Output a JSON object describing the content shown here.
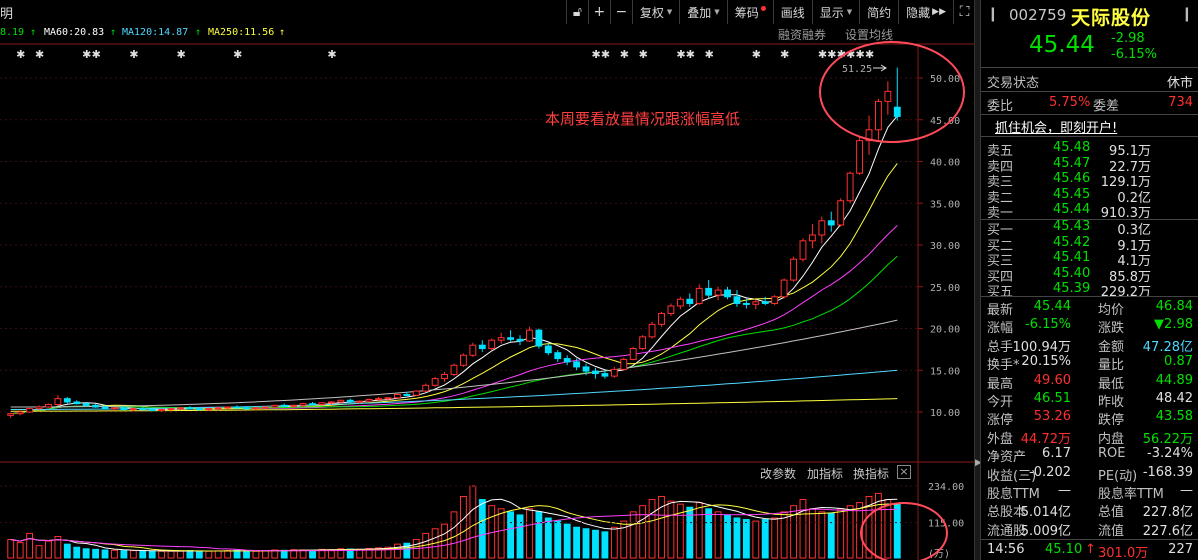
{
  "toolbar": {
    "left_text": "明",
    "items": [
      {
        "label": "复权",
        "caret": true
      },
      {
        "label": "叠加",
        "caret": true
      },
      {
        "label": "筹码",
        "dot": true
      },
      {
        "label": "画线"
      },
      {
        "label": "显示",
        "caret": true
      },
      {
        "label": "简约"
      },
      {
        "label": "隐藏",
        "suffix": "▶▶"
      }
    ]
  },
  "ma": {
    "ma_partial": "8.19",
    "ma60": "MA60:20.83",
    "ma120": "MA120:14.87",
    "ma250": "MA250:11.56",
    "links": [
      "融资融券",
      "设置均线"
    ],
    "colors": {
      "ma60": "#ffffff",
      "ma120": "#4fd8ff",
      "ma250": "#ffff40"
    }
  },
  "annotation": "本周要看放量情况跟涨幅高低",
  "high_label": "51.25",
  "price_axis": [
    "50.00",
    "45.00",
    "40.00",
    "35.00",
    "30.00",
    "25.00",
    "20.00",
    "15.00",
    "10.00"
  ],
  "volume_panel": {
    "links": [
      "改参数",
      "加指标",
      "换指标"
    ],
    "axis": [
      "234.00",
      "115.00",
      "(万)"
    ]
  },
  "panel": {
    "code": "002759",
    "name": "天际股份",
    "price": "45.44",
    "change": "-2.98",
    "change_pct": "-6.15%",
    "status_label": "交易状态",
    "status_value": "休市",
    "weibi_label": "委比",
    "weibi_value": "5.75%",
    "weicha_label": "委差",
    "weicha_value": "734",
    "promo": "抓住机会，即刻开户!",
    "asks": [
      {
        "label": "卖五",
        "price": "45.48",
        "vol": "95.1万"
      },
      {
        "label": "卖四",
        "price": "45.47",
        "vol": "22.7万"
      },
      {
        "label": "卖三",
        "price": "45.46",
        "vol": "129.1万"
      },
      {
        "label": "卖二",
        "price": "45.45",
        "vol": "0.2亿"
      },
      {
        "label": "卖一",
        "price": "45.44",
        "vol": "910.3万"
      }
    ],
    "bids": [
      {
        "label": "买一",
        "price": "45.43",
        "vol": "0.3亿"
      },
      {
        "label": "买二",
        "price": "45.42",
        "vol": "9.1万"
      },
      {
        "label": "买三",
        "price": "45.41",
        "vol": "4.1万"
      },
      {
        "label": "买四",
        "price": "45.40",
        "vol": "85.8万"
      },
      {
        "label": "买五",
        "price": "45.39",
        "vol": "229.2万"
      }
    ],
    "stats": [
      {
        "l1": "最新",
        "v1": "45.44",
        "c1": "c-g",
        "l2": "均价",
        "v2": "46.84",
        "c2": "c-g"
      },
      {
        "l1": "涨幅",
        "v1": "-6.15%",
        "c1": "c-g",
        "l2": "涨跌",
        "v2": "▼2.98",
        "c2": "c-g"
      },
      {
        "l1": "总手",
        "v1": "100.94万",
        "c1": "c-w",
        "l2": "金额",
        "v2": "47.28亿",
        "c2": "c-c"
      },
      {
        "l1": "换手*",
        "v1": "20.15%",
        "c1": "c-w",
        "l2": "量比",
        "v2": "0.87",
        "c2": "c-g"
      },
      {
        "l1": "最高",
        "v1": "49.60",
        "c1": "c-r",
        "l2": "最低",
        "v2": "44.89",
        "c2": "c-g"
      },
      {
        "l1": "今开",
        "v1": "46.51",
        "c1": "c-g",
        "l2": "昨收",
        "v2": "48.42",
        "c2": "c-w"
      },
      {
        "l1": "涨停",
        "v1": "53.26",
        "c1": "c-r",
        "l2": "跌停",
        "v2": "43.58",
        "c2": "c-g"
      },
      {
        "l1": "外盘",
        "v1": "44.72万",
        "c1": "c-r",
        "l2": "内盘",
        "v2": "56.22万",
        "c2": "c-g"
      },
      {
        "l1": "净资产",
        "v1": "6.17",
        "c1": "c-w",
        "l2": "ROE",
        "v2": "-3.24%",
        "c2": "c-w"
      },
      {
        "l1": "收益(三)",
        "v1": "-0.202",
        "c1": "c-w",
        "l2": "PE(动)",
        "v2": "-168.39",
        "c2": "c-w"
      },
      {
        "l1": "股息TTM",
        "v1": "—",
        "c1": "c-w",
        "l2": "股息率TTM",
        "v2": "—",
        "c2": "c-w"
      },
      {
        "l1": "总股本",
        "v1": "5.014亿",
        "c1": "c-w",
        "l2": "总值",
        "v2": "227.8亿",
        "c2": "c-w"
      },
      {
        "l1": "流通股",
        "v1": "5.009亿",
        "c1": "c-w",
        "l2": "流值",
        "v2": "227.6亿",
        "c2": "c-w"
      }
    ],
    "tick": {
      "time": "14:56",
      "price": "45.10",
      "arrow": "↑",
      "vol": "301.0万",
      "count": "227"
    }
  },
  "chart_data": {
    "type": "candlestick",
    "price_range": [
      7,
      53
    ],
    "candles": [
      [
        9.6,
        9.9,
        9.3,
        9.8
      ],
      [
        9.8,
        10.2,
        9.6,
        10.0
      ],
      [
        10.0,
        10.5,
        9.9,
        10.4
      ],
      [
        10.4,
        10.8,
        10.2,
        10.6
      ],
      [
        10.6,
        11.0,
        10.5,
        10.9
      ],
      [
        10.9,
        12.0,
        10.8,
        11.6
      ],
      [
        11.6,
        11.8,
        11.0,
        11.2
      ],
      [
        11.2,
        11.4,
        10.9,
        11.0
      ],
      [
        11.0,
        11.2,
        10.6,
        10.8
      ],
      [
        10.8,
        11.0,
        10.5,
        10.6
      ],
      [
        10.6,
        10.8,
        10.3,
        10.4
      ],
      [
        10.4,
        10.6,
        10.2,
        10.5
      ],
      [
        10.5,
        10.7,
        10.2,
        10.3
      ],
      [
        10.3,
        10.5,
        10.1,
        10.4
      ],
      [
        10.4,
        10.6,
        10.2,
        10.3
      ],
      [
        10.3,
        10.5,
        10.1,
        10.2
      ],
      [
        10.2,
        10.4,
        10.0,
        10.3
      ],
      [
        10.3,
        10.5,
        10.1,
        10.4
      ],
      [
        10.4,
        10.6,
        10.2,
        10.5
      ],
      [
        10.5,
        10.7,
        10.3,
        10.4
      ],
      [
        10.4,
        10.6,
        10.2,
        10.3
      ],
      [
        10.3,
        10.5,
        10.1,
        10.4
      ],
      [
        10.4,
        10.6,
        10.2,
        10.5
      ],
      [
        10.5,
        10.7,
        10.3,
        10.6
      ],
      [
        10.6,
        10.8,
        10.4,
        10.5
      ],
      [
        10.5,
        10.7,
        10.3,
        10.4
      ],
      [
        10.4,
        10.6,
        10.2,
        10.5
      ],
      [
        10.5,
        10.7,
        10.3,
        10.6
      ],
      [
        10.6,
        10.9,
        10.5,
        10.8
      ],
      [
        10.8,
        11.0,
        10.6,
        10.7
      ],
      [
        10.7,
        10.9,
        10.5,
        10.8
      ],
      [
        10.8,
        11.1,
        10.6,
        11.0
      ],
      [
        11.0,
        11.2,
        10.8,
        10.9
      ],
      [
        10.9,
        11.2,
        10.8,
        11.1
      ],
      [
        11.1,
        11.3,
        10.9,
        11.2
      ],
      [
        11.2,
        11.5,
        11.0,
        11.4
      ],
      [
        11.4,
        11.6,
        11.1,
        11.2
      ],
      [
        11.2,
        11.4,
        11.0,
        11.3
      ],
      [
        11.3,
        11.6,
        11.2,
        11.5
      ],
      [
        11.5,
        11.8,
        11.3,
        11.6
      ],
      [
        11.6,
        11.8,
        11.4,
        11.7
      ],
      [
        11.7,
        12.2,
        11.6,
        12.1
      ],
      [
        12.1,
        12.4,
        11.9,
        12.0
      ],
      [
        12.0,
        12.6,
        11.9,
        12.5
      ],
      [
        12.5,
        13.4,
        12.4,
        13.2
      ],
      [
        13.2,
        14.2,
        13.0,
        14.0
      ],
      [
        14.0,
        14.8,
        13.6,
        14.5
      ],
      [
        14.5,
        15.8,
        14.3,
        15.6
      ],
      [
        15.6,
        17.0,
        15.4,
        16.8
      ],
      [
        16.8,
        18.3,
        16.6,
        18.0
      ],
      [
        18.0,
        18.6,
        17.2,
        17.6
      ],
      [
        17.6,
        18.8,
        17.4,
        18.6
      ],
      [
        18.6,
        19.5,
        18.2,
        18.9
      ],
      [
        18.9,
        19.8,
        18.4,
        18.7
      ],
      [
        18.7,
        19.2,
        18.0,
        18.5
      ],
      [
        18.5,
        20.2,
        18.4,
        19.8
      ],
      [
        19.8,
        20.0,
        17.6,
        17.9
      ],
      [
        17.9,
        18.3,
        16.8,
        17.1
      ],
      [
        17.1,
        17.4,
        16.0,
        16.4
      ],
      [
        16.4,
        16.8,
        15.6,
        16.0
      ],
      [
        16.0,
        16.4,
        15.0,
        15.4
      ],
      [
        15.4,
        15.8,
        14.4,
        14.9
      ],
      [
        14.9,
        15.3,
        14.0,
        14.6
      ],
      [
        14.6,
        15.0,
        14.0,
        14.3
      ],
      [
        14.3,
        15.4,
        14.1,
        15.1
      ],
      [
        15.1,
        16.5,
        15.0,
        16.3
      ],
      [
        16.3,
        17.8,
        16.2,
        17.6
      ],
      [
        17.6,
        19.2,
        17.4,
        19.0
      ],
      [
        19.0,
        20.8,
        18.8,
        20.5
      ],
      [
        20.5,
        22.0,
        20.2,
        21.8
      ],
      [
        21.8,
        23.0,
        21.5,
        22.7
      ],
      [
        22.7,
        23.8,
        22.3,
        23.5
      ],
      [
        23.5,
        24.2,
        22.6,
        23.0
      ],
      [
        23.0,
        25.3,
        22.8,
        24.8
      ],
      [
        24.8,
        25.8,
        23.6,
        24.0
      ],
      [
        24.0,
        25.0,
        23.4,
        24.6
      ],
      [
        24.6,
        25.0,
        23.5,
        23.8
      ],
      [
        23.8,
        24.6,
        22.6,
        23.0
      ],
      [
        23.0,
        23.6,
        22.4,
        22.9
      ],
      [
        22.9,
        23.5,
        22.3,
        23.2
      ],
      [
        23.2,
        23.8,
        22.8,
        23.0
      ],
      [
        23.0,
        24.0,
        22.8,
        23.8
      ],
      [
        23.8,
        26.0,
        23.6,
        25.8
      ],
      [
        25.8,
        28.6,
        25.6,
        28.3
      ],
      [
        28.3,
        30.8,
        28.0,
        30.5
      ],
      [
        30.5,
        32.5,
        29.6,
        31.2
      ],
      [
        31.2,
        33.4,
        30.2,
        32.9
      ],
      [
        32.9,
        34.0,
        31.6,
        32.4
      ],
      [
        32.4,
        35.6,
        32.2,
        35.3
      ],
      [
        35.3,
        38.8,
        35.0,
        38.6
      ],
      [
        38.6,
        43.0,
        38.4,
        42.5
      ],
      [
        42.5,
        45.5,
        40.8,
        43.8
      ],
      [
        43.8,
        47.5,
        42.6,
        47.2
      ],
      [
        47.2,
        49.6,
        45.6,
        48.4
      ],
      [
        46.5,
        51.25,
        44.9,
        45.4
      ]
    ],
    "volumes": [
      60,
      50,
      80,
      40,
      55,
      70,
      45,
      35,
      30,
      28,
      26,
      25,
      24,
      24,
      23,
      22,
      22,
      22,
      23,
      24,
      22,
      22,
      23,
      24,
      25,
      23,
      22,
      24,
      26,
      25,
      27,
      26,
      25,
      28,
      27,
      30,
      29,
      28,
      31,
      33,
      35,
      45,
      48,
      60,
      80,
      95,
      110,
      150,
      200,
      234,
      190,
      170,
      160,
      150,
      140,
      160,
      150,
      130,
      120,
      110,
      100,
      95,
      90,
      85,
      100,
      120,
      150,
      170,
      190,
      200,
      185,
      175,
      165,
      180,
      160,
      150,
      140,
      130,
      125,
      120,
      125,
      130,
      150,
      170,
      190,
      160,
      150,
      145,
      160,
      170,
      180,
      200,
      210,
      190,
      175
    ],
    "ma_series_colors": [
      "#ffffff",
      "#ffff40",
      "#ff40ff",
      "#00e000",
      "#c0c0c0",
      "#4fd8ff",
      "#ffff40"
    ]
  }
}
